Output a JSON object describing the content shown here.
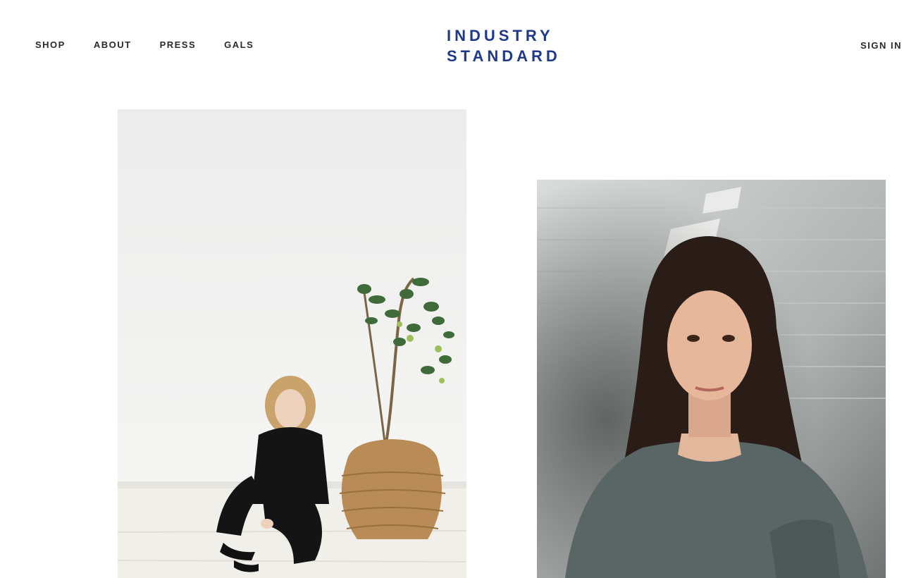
{
  "nav": {
    "links": [
      "SHOP",
      "ABOUT",
      "PRESS",
      "GALS"
    ],
    "signin": "SIGN IN"
  },
  "logo": {
    "line1": "INDUSTRY",
    "line2": "STANDARD"
  },
  "colors": {
    "brand": "#1f3a8a",
    "nav_text": "#2a2a2a",
    "background": "#ffffff"
  }
}
